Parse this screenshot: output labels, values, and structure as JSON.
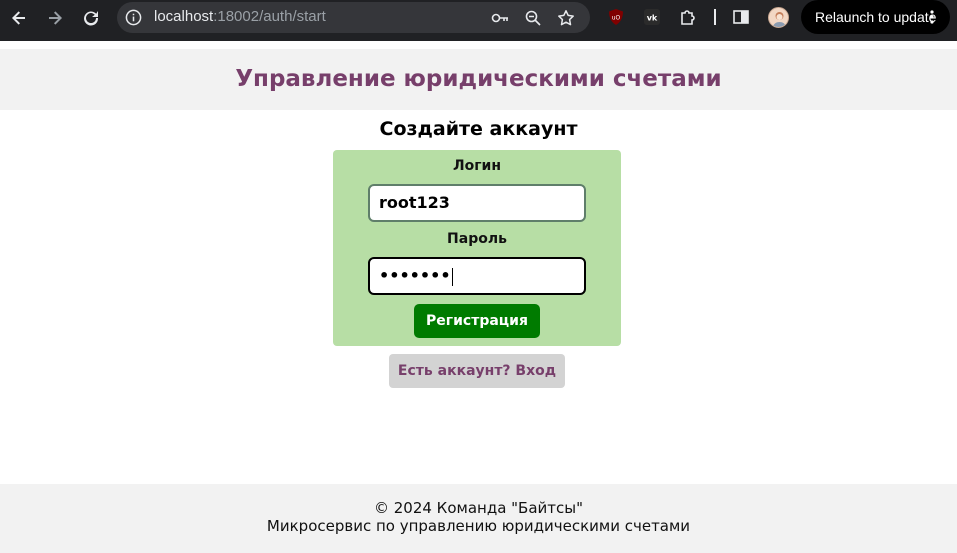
{
  "browser": {
    "url_host": "localhost",
    "url_rest": ":18002/auth/start",
    "relaunch_label": "Relaunch to update",
    "icons": [
      "back-icon",
      "forward-icon",
      "reload-icon",
      "site-info-icon",
      "key-icon",
      "zoom-icon",
      "star-icon",
      "ublock-icon",
      "vk-icon",
      "extensions-icon",
      "side-panel-icon",
      "avatar",
      "more-icon"
    ]
  },
  "header": {
    "title": "Управление юридическими счетами"
  },
  "form": {
    "heading": "Создайте аккаунт",
    "login_label": "Логин",
    "login_value": "root123",
    "password_label": "Пароль",
    "password_value": "•••••••",
    "submit_label": "Регистрация"
  },
  "login_link": {
    "label": "Есть аккаунт? Вход"
  },
  "footer": {
    "line1": "© 2024 Команда \"Байтсы\"",
    "line2": "Микросервис по управлению юридическими счетами"
  },
  "colors": {
    "title": "#773f6b",
    "panel": "#b7dea5",
    "submit": "#007b00",
    "link_bg": "#d3d3d3"
  }
}
